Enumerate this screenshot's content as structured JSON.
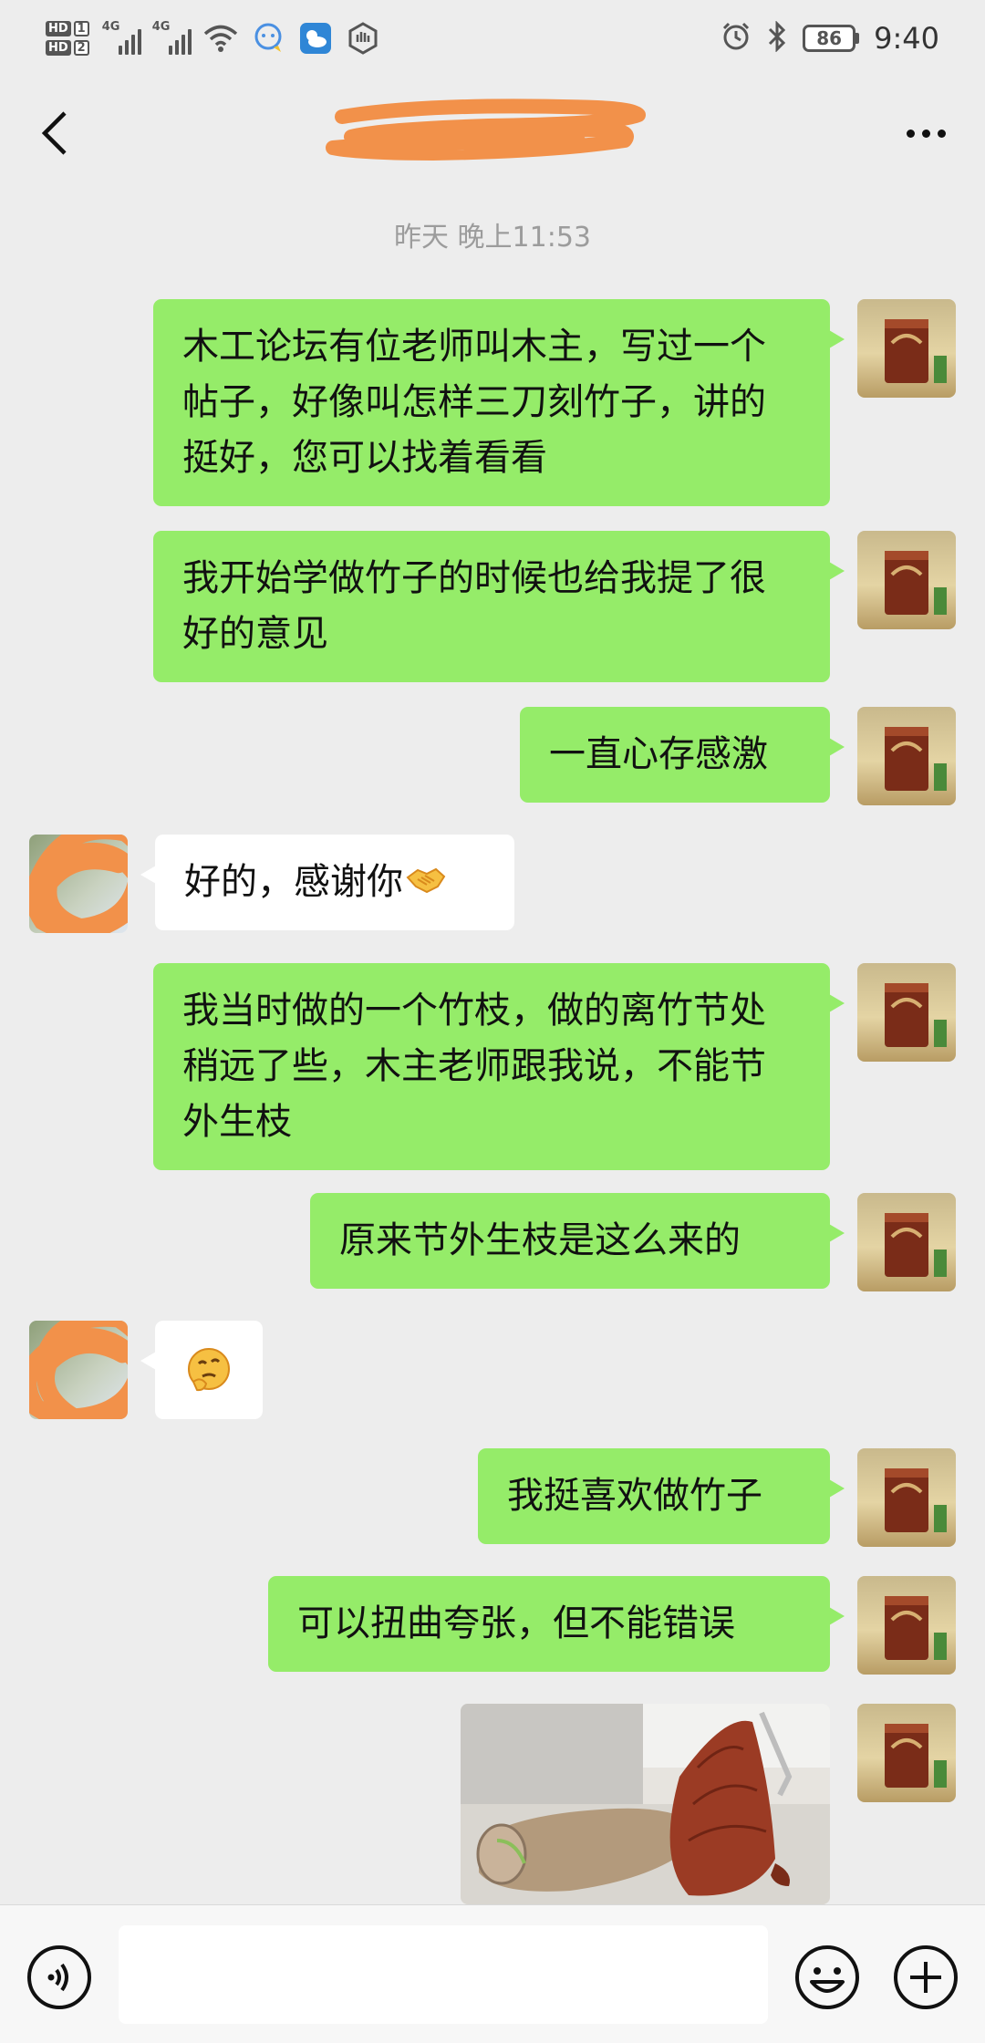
{
  "status_bar": {
    "sim_labels": [
      {
        "hd": "HD",
        "num": "1"
      },
      {
        "hd": "HD",
        "num": "2"
      }
    ],
    "network_labels": [
      "4G",
      "4G"
    ],
    "battery": "86",
    "time": "9:40"
  },
  "header": {
    "title": "",
    "back_icon": "chevron-left-icon",
    "more_icon": "more-dots-icon"
  },
  "chat": {
    "timestamp": "昨天 晚上11:53",
    "messages": [
      {
        "side": "right",
        "text": "木工论坛有位老师叫木主，写过一个帖子，好像叫怎样三刀刻竹子，讲的挺好，您可以找着看看"
      },
      {
        "side": "right",
        "text": "我开始学做竹子的时候也给我提了很好的意见"
      },
      {
        "side": "right",
        "text": "一直心存感激"
      },
      {
        "side": "left",
        "text": "好的，感谢你",
        "emoji": "handshake-emoji"
      },
      {
        "side": "right",
        "text": "我当时做的一个竹枝，做的离竹节处稍远了些，木主老师跟我说，不能节外生枝"
      },
      {
        "side": "right",
        "text": "原来节外生枝是这么来的"
      },
      {
        "side": "left",
        "text": "",
        "emoji": "thinking-face-emoji"
      },
      {
        "side": "right",
        "text": "我挺喜欢做竹子"
      },
      {
        "side": "right",
        "text": "可以扭曲夸张，但不能错误"
      },
      {
        "side": "right",
        "type": "image",
        "text": ""
      }
    ]
  },
  "input_bar": {
    "voice_icon": "voice-icon",
    "emoji_icon": "emoji-icon",
    "plus_icon": "plus-icon",
    "input_value": ""
  },
  "colors": {
    "background": "#ededed",
    "right_bubble": "#95ec69",
    "left_bubble": "#ffffff",
    "redaction": "#f2914a"
  }
}
